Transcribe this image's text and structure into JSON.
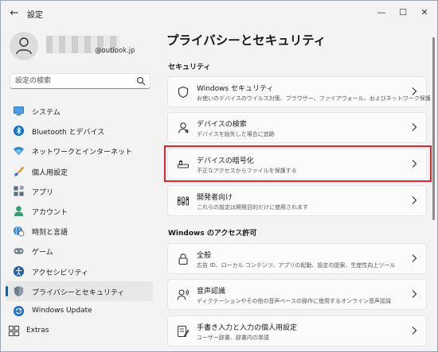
{
  "window": {
    "title": "設定",
    "back_glyph": "←",
    "minimize_glyph": "—",
    "maximize_glyph": "☐",
    "close_glyph": "✕"
  },
  "profile": {
    "email": "@outlook.jp"
  },
  "search": {
    "placeholder": "設定の検索"
  },
  "nav": {
    "items": [
      {
        "label": "システム",
        "icon": "monitor-icon"
      },
      {
        "label": "Bluetooth とデバイス",
        "icon": "bluetooth-icon"
      },
      {
        "label": "ネットワークとインターネット",
        "icon": "wifi-icon"
      },
      {
        "label": "個人用設定",
        "icon": "brush-icon"
      },
      {
        "label": "アプリ",
        "icon": "apps-icon"
      },
      {
        "label": "アカウント",
        "icon": "person-icon"
      },
      {
        "label": "時刻と言語",
        "icon": "globe-clock-icon"
      },
      {
        "label": "ゲーム",
        "icon": "gamepad-icon"
      },
      {
        "label": "アクセシビリティ",
        "icon": "accessibility-icon"
      },
      {
        "label": "プライバシーとセキュリティ",
        "icon": "shield-icon",
        "active": true
      },
      {
        "label": "Windows Update",
        "icon": "update-icon"
      },
      {
        "label": "Extras",
        "icon": "extras-icon"
      }
    ]
  },
  "main": {
    "title": "プライバシーとセキュリティ",
    "sections": [
      {
        "heading": "セキュリティ",
        "cards": [
          {
            "title": "Windows セキュリティ",
            "desc": "お使いのデバイスのウイルス対策、ブラウザー、ファイアウォール、およびネットワーク保護",
            "icon": "shield-outline-icon"
          },
          {
            "title": "デバイスの検索",
            "desc": "デバイスを紛失した場合に追跡",
            "icon": "find-device-icon"
          },
          {
            "title": "デバイスの暗号化",
            "desc": "不正なアクセスからファイルを保護する",
            "icon": "encryption-icon",
            "highlighted": true
          },
          {
            "title": "開発者向け",
            "desc": "これらの設定は開発目的だけに使用されます",
            "icon": "developer-icon"
          }
        ]
      },
      {
        "heading": "Windows のアクセス許可",
        "cards": [
          {
            "title": "全般",
            "desc": "広告 ID、ローカル コンテンツ、アプリの起動、設定の提案、生産性向上ツール",
            "icon": "lock-icon"
          },
          {
            "title": "音声認識",
            "desc": "ディクテーションやその他の音声ベースの操作に使用するオンライン音声認識",
            "icon": "speech-icon"
          },
          {
            "title": "手書き入力と入力の個人用設定",
            "desc": "ユーザー辞書、辞書内の単語",
            "icon": "handwriting-icon"
          }
        ]
      }
    ]
  },
  "colors": {
    "accent": "#005fb8",
    "highlight": "#e0242d",
    "background": "#f3f3f3",
    "card": "#fbfbfb"
  }
}
